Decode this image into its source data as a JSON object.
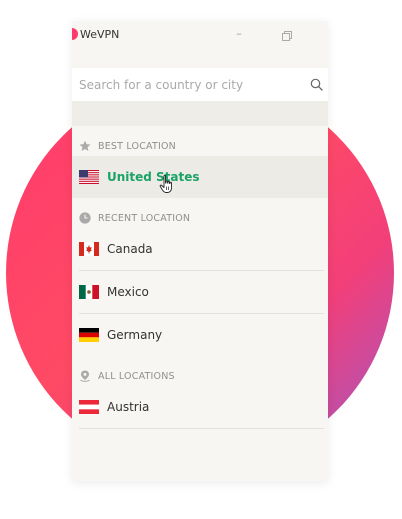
{
  "app": {
    "title": "WeVPN",
    "minimize_glyph": "–"
  },
  "search": {
    "placeholder": "Search for a country or city",
    "value": ""
  },
  "sections": {
    "best": {
      "label": "BEST LOCATION",
      "icon": "star-icon"
    },
    "recent": {
      "label": "RECENT LOCATION",
      "icon": "clock-icon"
    },
    "all": {
      "label": "ALL LOCATIONS",
      "icon": "location-pin-icon"
    }
  },
  "best_location": {
    "name": "United States",
    "flag": "us-flag",
    "selected": true
  },
  "recent_locations": [
    {
      "name": "Canada",
      "flag": "canada-flag"
    },
    {
      "name": "Mexico",
      "flag": "mexico-flag"
    },
    {
      "name": "Germany",
      "flag": "germany-flag"
    }
  ],
  "all_locations": [
    {
      "name": "Austria",
      "flag": "austria-flag"
    }
  ],
  "colors": {
    "accent": "#1aa267",
    "brand": "#ff3b6d",
    "background_gradient_end": "#9b5ac7",
    "window_bg": "#f7f6f2"
  }
}
